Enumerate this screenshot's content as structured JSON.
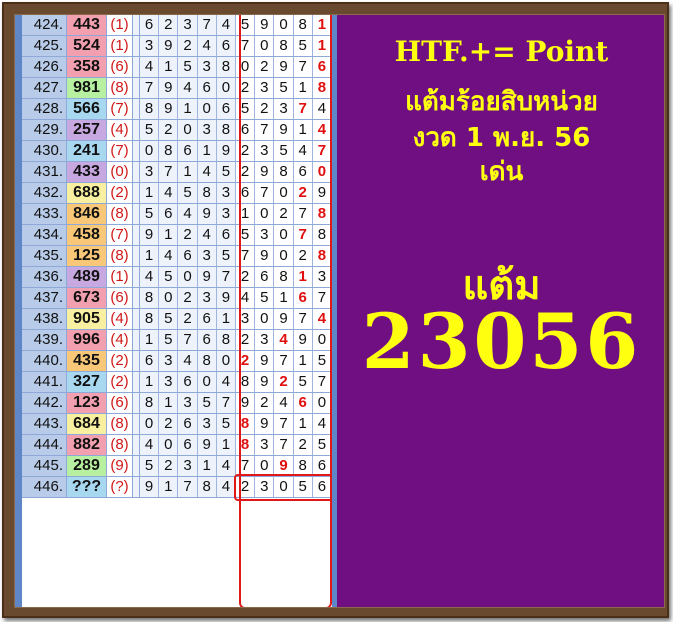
{
  "panel": {
    "title": "HTF.+= Point",
    "line1": "แต้มร้อยสิบหน่วย",
    "line2": "งวด 1 พ.ย. 56",
    "line3": "เด่น",
    "label": "แต้ม",
    "number": "23056"
  },
  "rows": [
    {
      "idx": "424.",
      "num": "443",
      "color": "#f2a0b0",
      "par": "(1)",
      "digits": [
        "6",
        "2",
        "3",
        "7",
        "4",
        "5",
        "9",
        "0",
        "8",
        "1"
      ],
      "hi": [
        9
      ]
    },
    {
      "idx": "425.",
      "num": "524",
      "color": "#f2a0b0",
      "par": "(1)",
      "digits": [
        "3",
        "9",
        "2",
        "4",
        "6",
        "7",
        "0",
        "8",
        "5",
        "1"
      ],
      "hi": [
        9
      ]
    },
    {
      "idx": "426.",
      "num": "358",
      "color": "#f2a0b0",
      "par": "(6)",
      "digits": [
        "4",
        "1",
        "5",
        "3",
        "8",
        "0",
        "2",
        "9",
        "7",
        "6"
      ],
      "hi": [
        9
      ]
    },
    {
      "idx": "427.",
      "num": "981",
      "color": "#b6f0a0",
      "par": "(8)",
      "digits": [
        "7",
        "9",
        "4",
        "6",
        "0",
        "2",
        "3",
        "5",
        "1",
        "8"
      ],
      "hi": [
        9
      ]
    },
    {
      "idx": "428.",
      "num": "566",
      "color": "#a8d8f0",
      "par": "(7)",
      "digits": [
        "8",
        "9",
        "1",
        "0",
        "6",
        "5",
        "2",
        "3",
        "7",
        "4"
      ],
      "hi": [
        8
      ]
    },
    {
      "idx": "429.",
      "num": "257",
      "color": "#c8a8e0",
      "par": "(4)",
      "digits": [
        "5",
        "2",
        "0",
        "3",
        "8",
        "6",
        "7",
        "9",
        "1",
        "4"
      ],
      "hi": [
        9
      ]
    },
    {
      "idx": "430.",
      "num": "241",
      "color": "#a8d8f0",
      "par": "(7)",
      "digits": [
        "0",
        "8",
        "6",
        "1",
        "9",
        "2",
        "3",
        "5",
        "4",
        "7"
      ],
      "hi": [
        9
      ]
    },
    {
      "idx": "431.",
      "num": "433",
      "color": "#c8a8e0",
      "par": "(0)",
      "digits": [
        "3",
        "7",
        "1",
        "4",
        "5",
        "2",
        "9",
        "8",
        "6",
        "0"
      ],
      "hi": [
        9
      ]
    },
    {
      "idx": "432.",
      "num": "688",
      "color": "#f8f0a0",
      "par": "(2)",
      "digits": [
        "1",
        "4",
        "5",
        "8",
        "3",
        "6",
        "7",
        "0",
        "2",
        "9"
      ],
      "hi": [
        8
      ]
    },
    {
      "idx": "433.",
      "num": "846",
      "color": "#f8c878",
      "par": "(8)",
      "digits": [
        "5",
        "6",
        "4",
        "9",
        "3",
        "1",
        "0",
        "2",
        "7",
        "8"
      ],
      "hi": [
        9
      ]
    },
    {
      "idx": "434.",
      "num": "458",
      "color": "#f8c878",
      "par": "(7)",
      "digits": [
        "9",
        "1",
        "2",
        "4",
        "6",
        "5",
        "3",
        "0",
        "7",
        "8"
      ],
      "hi": [
        8
      ]
    },
    {
      "idx": "435.",
      "num": "125",
      "color": "#f8c878",
      "par": "(8)",
      "digits": [
        "1",
        "4",
        "6",
        "3",
        "5",
        "7",
        "9",
        "0",
        "2",
        "8"
      ],
      "hi": [
        9
      ]
    },
    {
      "idx": "436.",
      "num": "489",
      "color": "#c8a8e0",
      "par": "(1)",
      "digits": [
        "4",
        "5",
        "0",
        "9",
        "7",
        "2",
        "6",
        "8",
        "1",
        "3"
      ],
      "hi": [
        8
      ]
    },
    {
      "idx": "437.",
      "num": "673",
      "color": "#f2a0b0",
      "par": "(6)",
      "digits": [
        "8",
        "0",
        "2",
        "3",
        "9",
        "4",
        "5",
        "1",
        "6",
        "7"
      ],
      "hi": [
        8
      ]
    },
    {
      "idx": "438.",
      "num": "905",
      "color": "#f8f0a0",
      "par": "(4)",
      "digits": [
        "8",
        "5",
        "2",
        "6",
        "1",
        "3",
        "0",
        "9",
        "7",
        "4"
      ],
      "hi": [
        9
      ]
    },
    {
      "idx": "439.",
      "num": "996",
      "color": "#f2a0b0",
      "par": "(4)",
      "digits": [
        "1",
        "5",
        "7",
        "6",
        "8",
        "2",
        "3",
        "4",
        "9",
        "0"
      ],
      "hi": [
        7
      ]
    },
    {
      "idx": "440.",
      "num": "435",
      "color": "#f8c878",
      "par": "(2)",
      "digits": [
        "6",
        "3",
        "4",
        "8",
        "0",
        "2",
        "9",
        "7",
        "1",
        "5"
      ],
      "hi": [
        5
      ]
    },
    {
      "idx": "441.",
      "num": "327",
      "color": "#a8d8f0",
      "par": "(2)",
      "digits": [
        "1",
        "3",
        "6",
        "0",
        "4",
        "8",
        "9",
        "2",
        "5",
        "7"
      ],
      "hi": [
        7
      ]
    },
    {
      "idx": "442.",
      "num": "123",
      "color": "#f2a0b0",
      "par": "(6)",
      "digits": [
        "8",
        "1",
        "3",
        "5",
        "7",
        "9",
        "2",
        "4",
        "6",
        "0"
      ],
      "hi": [
        8
      ]
    },
    {
      "idx": "443.",
      "num": "684",
      "color": "#f8f0a0",
      "par": "(8)",
      "digits": [
        "0",
        "2",
        "6",
        "3",
        "5",
        "8",
        "9",
        "7",
        "1",
        "4"
      ],
      "hi": [
        5
      ]
    },
    {
      "idx": "444.",
      "num": "882",
      "color": "#f2a0b0",
      "par": "(8)",
      "digits": [
        "4",
        "0",
        "6",
        "9",
        "1",
        "8",
        "3",
        "7",
        "2",
        "5"
      ],
      "hi": [
        5
      ]
    },
    {
      "idx": "445.",
      "num": "289",
      "color": "#b6f0a0",
      "par": "(9)",
      "digits": [
        "5",
        "2",
        "3",
        "1",
        "4",
        "7",
        "0",
        "9",
        "8",
        "6"
      ],
      "hi": [
        7
      ]
    },
    {
      "idx": "446.",
      "num": "???",
      "color": "#a8d8f0",
      "par": "(?)",
      "digits": [
        "9",
        "1",
        "7",
        "8",
        "4",
        "2",
        "3",
        "0",
        "5",
        "6"
      ],
      "hi": []
    }
  ]
}
